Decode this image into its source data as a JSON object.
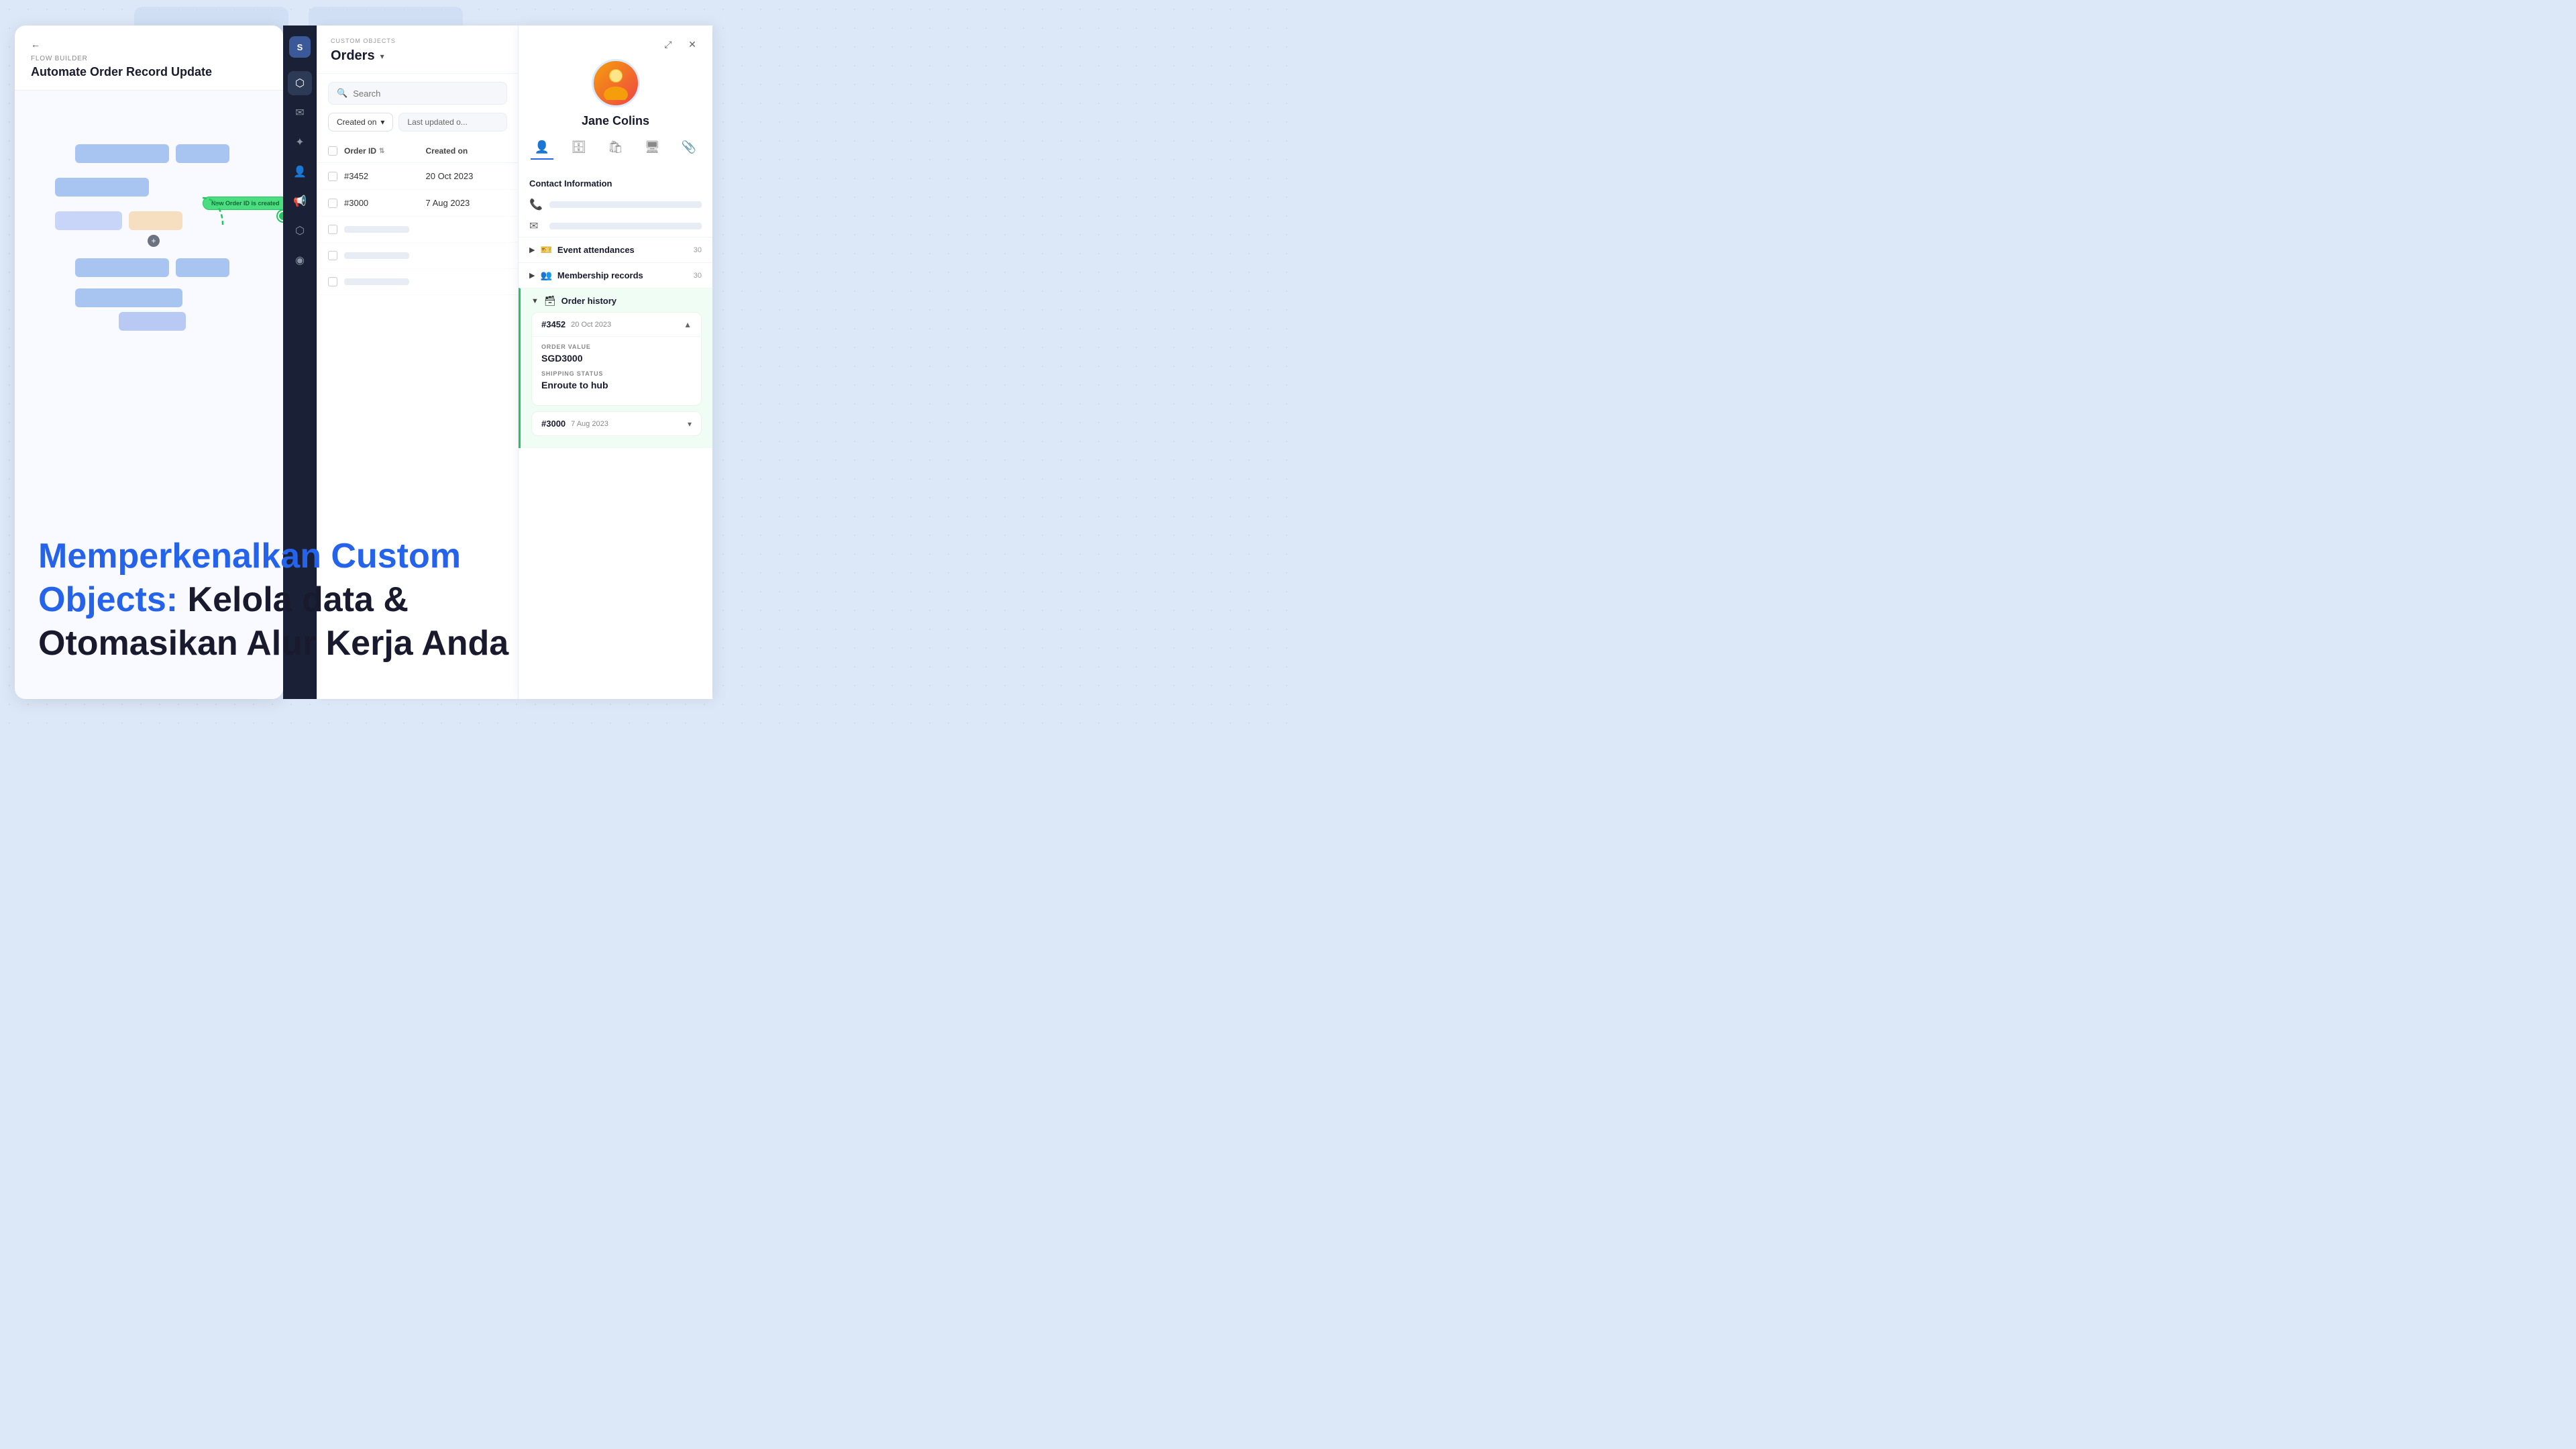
{
  "app": {
    "background_color": "#dce8f8"
  },
  "flow_builder": {
    "label": "FLOW BUILDER",
    "title": "Automate Order Record Update",
    "back_label": "←"
  },
  "sidebar": {
    "logo": "S",
    "items": [
      {
        "icon": "⬡",
        "label": "database",
        "active": true
      },
      {
        "icon": "✉",
        "label": "inbox",
        "active": false
      },
      {
        "icon": "✦",
        "label": "trigger",
        "active": false
      },
      {
        "icon": "👤",
        "label": "contacts",
        "active": false
      },
      {
        "icon": "📢",
        "label": "broadcast",
        "active": false
      },
      {
        "icon": "⬡",
        "label": "flows",
        "active": false
      },
      {
        "icon": "◉",
        "label": "channels",
        "active": false
      }
    ]
  },
  "custom_objects": {
    "label": "CUSTOM OBJECTS",
    "title": "Orders",
    "search_placeholder": "Search",
    "filter_created_on": "Created on",
    "filter_last_updated": "Last updated o...",
    "table": {
      "columns": [
        "Order ID",
        "Created on"
      ],
      "rows": [
        {
          "order_id": "#3452",
          "created_on": "20 Oct 2023"
        },
        {
          "order_id": "#3000",
          "created_on": "7 Aug 2023"
        }
      ]
    }
  },
  "trigger": {
    "label": "New Order ID is created"
  },
  "contact": {
    "name": "Jane Colins",
    "sections": {
      "contact_information": "Contact Information",
      "event_attendances": "Event attendances",
      "membership_records": "Membership records",
      "order_history": "Order history"
    },
    "orders": [
      {
        "id": "#3452",
        "date": "20 Oct 2023",
        "order_value_label": "ORDER VALUE",
        "order_value": "SGD3000",
        "shipping_status_label": "SHIPPING STATUS",
        "shipping_status": "Enroute to hub",
        "expanded": true
      },
      {
        "id": "#3000",
        "date": "7 Aug 2023",
        "expanded": false
      }
    ]
  },
  "headline": {
    "line1_blue": "Memperkenalkan Custom",
    "line2_blue": "Objects:",
    "line2_dark": " Kelola data &",
    "line3_dark": "Otomasikan Alur Kerja Anda"
  }
}
